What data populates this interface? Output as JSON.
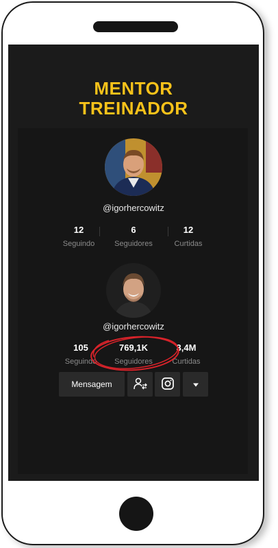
{
  "headline": {
    "line1": "MENTOR",
    "line2": "TREINADOR"
  },
  "profile_top": {
    "username": "@igorhercowitz",
    "stats": [
      {
        "value": "12",
        "label": "Seguindo"
      },
      {
        "value": "6",
        "label": "Seguidores"
      },
      {
        "value": "12",
        "label": "Curtidas"
      }
    ]
  },
  "profile_bottom": {
    "username": "@igorhercowitz",
    "stats": [
      {
        "value": "105",
        "label": "Seguindo"
      },
      {
        "value": "769,1K",
        "label": "Seguidores"
      },
      {
        "value": "3,4M",
        "label": "Curtidas"
      }
    ],
    "actions": {
      "message_label": "Mensagem",
      "follow_icon": "user-swap-icon",
      "instagram_icon": "instagram-icon",
      "more_icon": "caret-down-icon"
    }
  },
  "colors": {
    "headline": "#f7c21a",
    "highlight_ring": "#d8232a",
    "screen_bg": "#1b1b1b"
  }
}
